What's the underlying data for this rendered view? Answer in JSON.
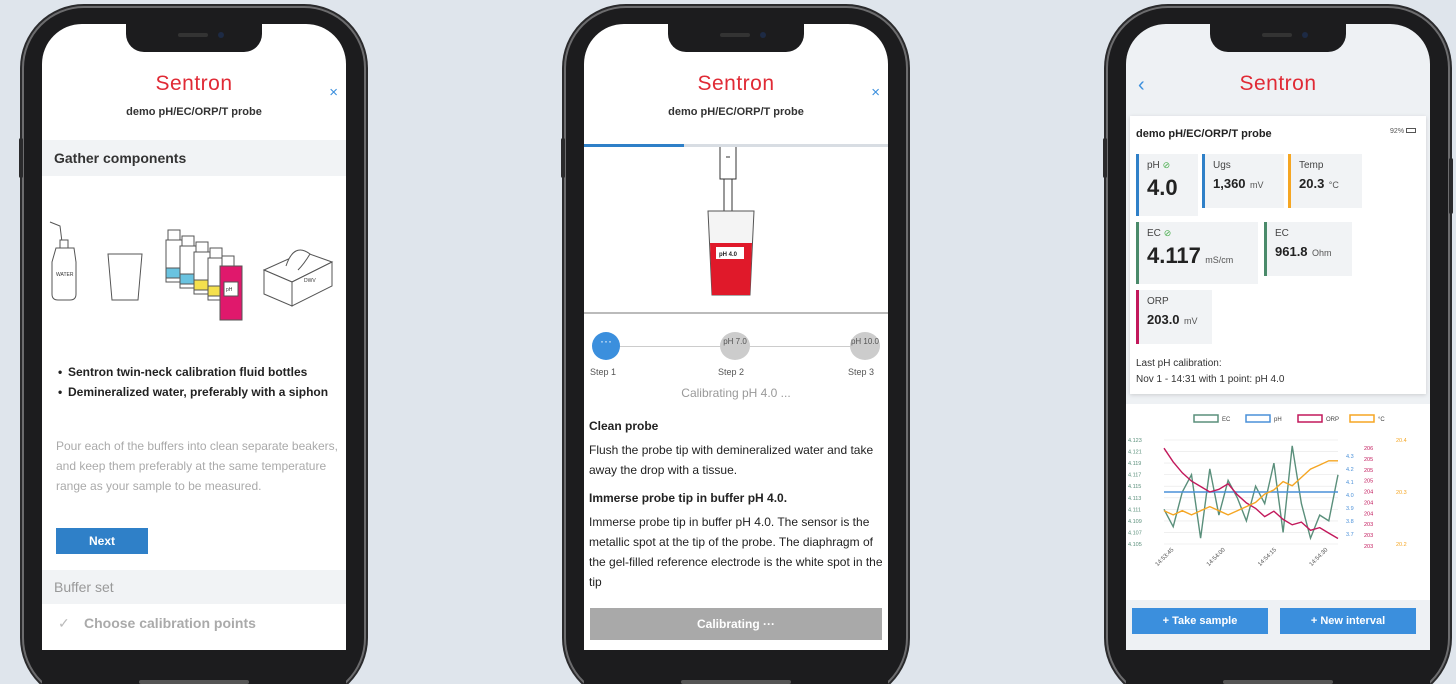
{
  "brand": "Sentron",
  "probe_name": "demo pH/EC/ORP/T probe",
  "phone1": {
    "close_label": "×",
    "section_title": "Gather components",
    "illustration_labels": [
      "WATER",
      "pH4",
      "pH7",
      "pH10",
      "pH",
      "DWV"
    ],
    "items": [
      "Sentron twin-neck calibration fluid bottles",
      "Demineralized water, preferably with a siphon"
    ],
    "description": "Pour each of the buffers into clean separate beakers, and keep them preferably at the same temperature range as your sample to be measured.",
    "next_label": "Next",
    "buffer_set_label": "Buffer set",
    "check_glyph": "✓",
    "choose_points_label": "Choose calibration points"
  },
  "phone2": {
    "close_label": "×",
    "progress_fraction": 0.33,
    "beaker_label": "pH 4.0",
    "steps": [
      {
        "circle": "···",
        "label": "Step 1"
      },
      {
        "circle": "pH 7.0",
        "label": "Step 2"
      },
      {
        "circle": "pH 10.0",
        "label": "Step 3"
      }
    ],
    "calibrating_status": "Calibrating pH 4.0 ...",
    "clean_title": "Clean probe",
    "clean_text": "Flush the probe tip with demineralized water and take away the drop with a tissue.",
    "immerse_title": "Immerse probe tip in buffer pH 4.0.",
    "immerse_text": "Immerse probe tip in buffer pH 4.0. The sensor is the metallic spot at the tip of the probe. The diaphragm of the gel-filled reference electrode is the white spot in the tip",
    "calibrating_button": "Calibrating  ···"
  },
  "phone3": {
    "back_label": "‹",
    "battery": "92%",
    "tiles": {
      "ph": {
        "label": "pH",
        "value": "4.0",
        "check": "⊘",
        "color": "#2f80c8"
      },
      "ugs": {
        "label": "Ugs",
        "value": "1,360",
        "unit": "mV",
        "color": "#2f80c8"
      },
      "temp": {
        "label": "Temp",
        "value": "20.3",
        "unit": "°C",
        "color": "#f5a623"
      },
      "ec": {
        "label": "EC",
        "value": "4.117",
        "unit": "mS/cm",
        "check": "⊘",
        "color": "#4a8a6a"
      },
      "ec2": {
        "label": "EC",
        "value": "961.8",
        "unit": "Ohm",
        "color": "#4a8a6a"
      },
      "orp": {
        "label": "ORP",
        "value": "203.0",
        "unit": "mV",
        "color": "#c2185b"
      }
    },
    "last_cal_label": "Last pH calibration:",
    "last_cal_value": "Nov 1 - 14:31 with 1 point: pH 4.0",
    "take_sample": "+ Take sample",
    "new_interval": "+ New interval"
  },
  "chart_data": {
    "type": "line",
    "legend": [
      "EC",
      "pH",
      "ORP",
      "°C"
    ],
    "x_ticks": [
      "14:53:45",
      "14:54:00",
      "14:54:15",
      "14:54:30"
    ],
    "series": [
      {
        "name": "EC",
        "axis": "EC",
        "color": "#5a8f7b",
        "values": [
          4.111,
          4.108,
          4.114,
          4.117,
          4.106,
          4.118,
          4.11,
          4.116,
          4.113,
          4.109,
          4.115,
          4.112,
          4.119,
          4.107,
          4.122,
          4.112,
          4.106,
          4.11,
          4.109,
          4.117
        ]
      },
      {
        "name": "pH",
        "axis": "pH",
        "color": "#4a90d9",
        "values": [
          4.0,
          4.0,
          4.0,
          4.0,
          4.0,
          4.0,
          4.0,
          4.0,
          4.0,
          4.0,
          4.0,
          4.0,
          4.0,
          4.0,
          4.0,
          4.0,
          4.0,
          4.0,
          4.0,
          4.0
        ]
      },
      {
        "name": "ORP",
        "axis": "ORP",
        "color": "#c2185b",
        "values": [
          206.2,
          205.7,
          205.3,
          205.0,
          204.8,
          204.6,
          204.7,
          204.9,
          204.5,
          204.2,
          204.0,
          203.7,
          203.9,
          203.6,
          203.4,
          203.5,
          203.2,
          203.3,
          203.1,
          202.9
        ]
      },
      {
        "name": "°C",
        "axis": "T",
        "color": "#f5a623",
        "values": [
          20.28,
          20.27,
          20.28,
          20.27,
          20.28,
          20.29,
          20.28,
          20.27,
          20.28,
          20.29,
          20.3,
          20.32,
          20.33,
          20.35,
          20.34,
          20.36,
          20.38,
          20.39,
          20.4,
          20.4
        ]
      }
    ],
    "axes": {
      "EC": {
        "ticks": [
          "4.123",
          "4.121",
          "4.119",
          "4.117",
          "4.115",
          "4.113",
          "4.111",
          "4.109",
          "4.107",
          "4.105"
        ],
        "range": [
          4.105,
          4.123
        ]
      },
      "pH": {
        "ticks": [
          "4.3",
          "4.2",
          "4.1",
          "4.0",
          "3.9",
          "3.8",
          "3.7"
        ],
        "range": [
          3.6,
          4.4
        ]
      },
      "ORP": {
        "ticks": [
          "206",
          "205",
          "205",
          "205",
          "204",
          "204",
          "204",
          "203",
          "203",
          "203"
        ],
        "range": [
          202.7,
          206.5
        ]
      },
      "T": {
        "ticks": [
          "20.4",
          "20.3",
          "20.2"
        ],
        "range": [
          20.2,
          20.45
        ]
      }
    }
  }
}
